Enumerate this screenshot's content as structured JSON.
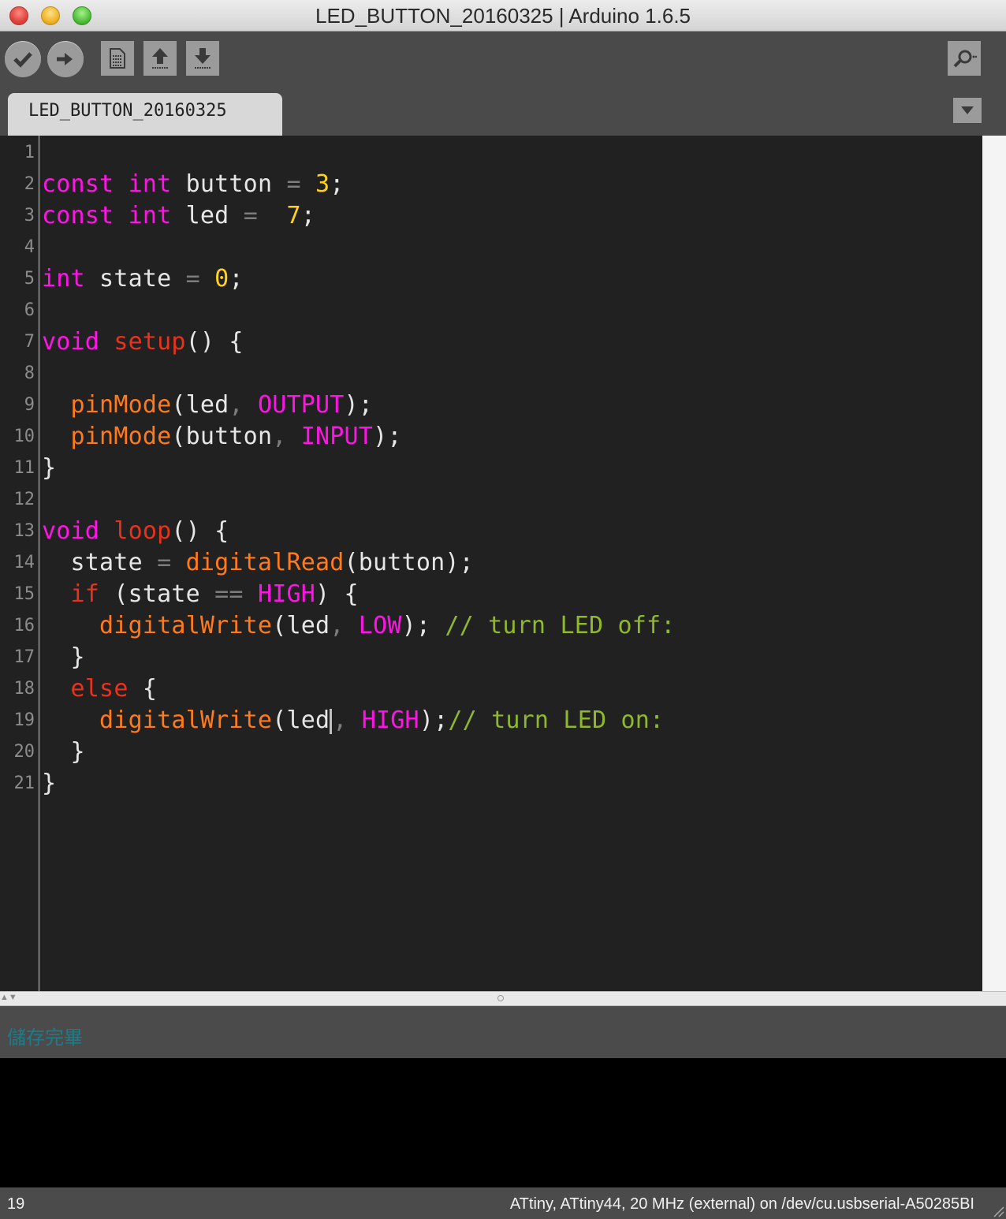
{
  "window": {
    "title": "LED_BUTTON_20160325 | Arduino 1.6.5"
  },
  "toolbar": {
    "buttons": [
      {
        "name": "verify",
        "icon": "checkmark-icon"
      },
      {
        "name": "upload",
        "icon": "right-arrow-icon"
      },
      {
        "name": "new",
        "icon": "new-document-icon"
      },
      {
        "name": "open",
        "icon": "up-arrow-icon"
      },
      {
        "name": "save",
        "icon": "down-arrow-icon"
      },
      {
        "name": "serial-monitor",
        "icon": "magnifier-icon"
      }
    ]
  },
  "tabs": {
    "active": "LED_BUTTON_20160325",
    "menu_icon": "triangle-down-icon"
  },
  "editor": {
    "line_numbers": [
      "1",
      "2",
      "3",
      "4",
      "5",
      "6",
      "7",
      "8",
      "9",
      "10",
      "11",
      "12",
      "13",
      "14",
      "15",
      "16",
      "17",
      "18",
      "19",
      "20",
      "21"
    ],
    "caret": {
      "line": 19
    },
    "lines": [
      [],
      [
        {
          "t": "const",
          "c": "kw"
        },
        {
          "t": " ",
          "c": "pl"
        },
        {
          "t": "int",
          "c": "kw"
        },
        {
          "t": " button ",
          "c": "pl"
        },
        {
          "t": "=",
          "c": "op"
        },
        {
          "t": " ",
          "c": "pl"
        },
        {
          "t": "3",
          "c": "num"
        },
        {
          "t": ";",
          "c": "pl"
        }
      ],
      [
        {
          "t": "const",
          "c": "kw"
        },
        {
          "t": " ",
          "c": "pl"
        },
        {
          "t": "int",
          "c": "kw"
        },
        {
          "t": " led ",
          "c": "pl"
        },
        {
          "t": "=",
          "c": "op"
        },
        {
          "t": "  ",
          "c": "pl"
        },
        {
          "t": "7",
          "c": "num"
        },
        {
          "t": ";",
          "c": "pl"
        }
      ],
      [],
      [
        {
          "t": "int",
          "c": "kw"
        },
        {
          "t": " state ",
          "c": "pl"
        },
        {
          "t": "=",
          "c": "op"
        },
        {
          "t": " ",
          "c": "pl"
        },
        {
          "t": "0",
          "c": "num"
        },
        {
          "t": ";",
          "c": "pl"
        }
      ],
      [],
      [
        {
          "t": "void",
          "c": "kw"
        },
        {
          "t": " ",
          "c": "pl"
        },
        {
          "t": "setup",
          "c": "ctl"
        },
        {
          "t": "() {",
          "c": "pl"
        }
      ],
      [],
      [
        {
          "t": "  ",
          "c": "pl"
        },
        {
          "t": "pinMode",
          "c": "fn"
        },
        {
          "t": "(led",
          "c": "pl"
        },
        {
          "t": ",",
          "c": "op"
        },
        {
          "t": " ",
          "c": "pl"
        },
        {
          "t": "OUTPUT",
          "c": "kw"
        },
        {
          "t": ");",
          "c": "pl"
        }
      ],
      [
        {
          "t": "  ",
          "c": "pl"
        },
        {
          "t": "pinMode",
          "c": "fn"
        },
        {
          "t": "(button",
          "c": "pl"
        },
        {
          "t": ",",
          "c": "op"
        },
        {
          "t": " ",
          "c": "pl"
        },
        {
          "t": "INPUT",
          "c": "kw"
        },
        {
          "t": ");",
          "c": "pl"
        }
      ],
      [
        {
          "t": "}",
          "c": "pl"
        }
      ],
      [],
      [
        {
          "t": "void",
          "c": "kw"
        },
        {
          "t": " ",
          "c": "pl"
        },
        {
          "t": "loop",
          "c": "ctl"
        },
        {
          "t": "() {",
          "c": "pl"
        }
      ],
      [
        {
          "t": "  state ",
          "c": "pl"
        },
        {
          "t": "=",
          "c": "op"
        },
        {
          "t": " ",
          "c": "pl"
        },
        {
          "t": "digitalRead",
          "c": "fn"
        },
        {
          "t": "(button);",
          "c": "pl"
        }
      ],
      [
        {
          "t": "  ",
          "c": "pl"
        },
        {
          "t": "if",
          "c": "ctl"
        },
        {
          "t": " (state ",
          "c": "pl"
        },
        {
          "t": "==",
          "c": "op"
        },
        {
          "t": " ",
          "c": "pl"
        },
        {
          "t": "HIGH",
          "c": "kw"
        },
        {
          "t": ") {",
          "c": "pl"
        }
      ],
      [
        {
          "t": "    ",
          "c": "pl"
        },
        {
          "t": "digitalWrite",
          "c": "fn"
        },
        {
          "t": "(led",
          "c": "pl"
        },
        {
          "t": ",",
          "c": "op"
        },
        {
          "t": " ",
          "c": "pl"
        },
        {
          "t": "LOW",
          "c": "kw"
        },
        {
          "t": "); ",
          "c": "pl"
        },
        {
          "t": "// turn LED off:",
          "c": "cm"
        }
      ],
      [
        {
          "t": "  }",
          "c": "pl"
        }
      ],
      [
        {
          "t": "  ",
          "c": "pl"
        },
        {
          "t": "else",
          "c": "ctl"
        },
        {
          "t": " {",
          "c": "pl"
        }
      ],
      [
        {
          "t": "    ",
          "c": "pl"
        },
        {
          "t": "digitalWrite",
          "c": "fn"
        },
        {
          "t": "(led",
          "c": "pl"
        },
        {
          "t": "|",
          "c": "caret"
        },
        {
          "t": ",",
          "c": "op"
        },
        {
          "t": " ",
          "c": "pl"
        },
        {
          "t": "HIGH",
          "c": "kw"
        },
        {
          "t": ");",
          "c": "pl"
        },
        {
          "t": "// turn LED on:",
          "c": "cm"
        }
      ],
      [
        {
          "t": "  }",
          "c": "pl"
        }
      ],
      [
        {
          "t": "}",
          "c": "pl"
        }
      ]
    ]
  },
  "colors": {
    "kw": "#ff14e6",
    "ctl": "#e8331c",
    "fn": "#ff7a1a",
    "num": "#ffd21a",
    "cm": "#8fb82e",
    "pl": "#e6e6e6",
    "op": "#7d7d7d"
  },
  "status": {
    "message": "儲存完畢"
  },
  "footer": {
    "line": "19",
    "board": "ATtiny, ATtiny44, 20 MHz (external) on /dev/cu.usbserial-A50285BI"
  }
}
